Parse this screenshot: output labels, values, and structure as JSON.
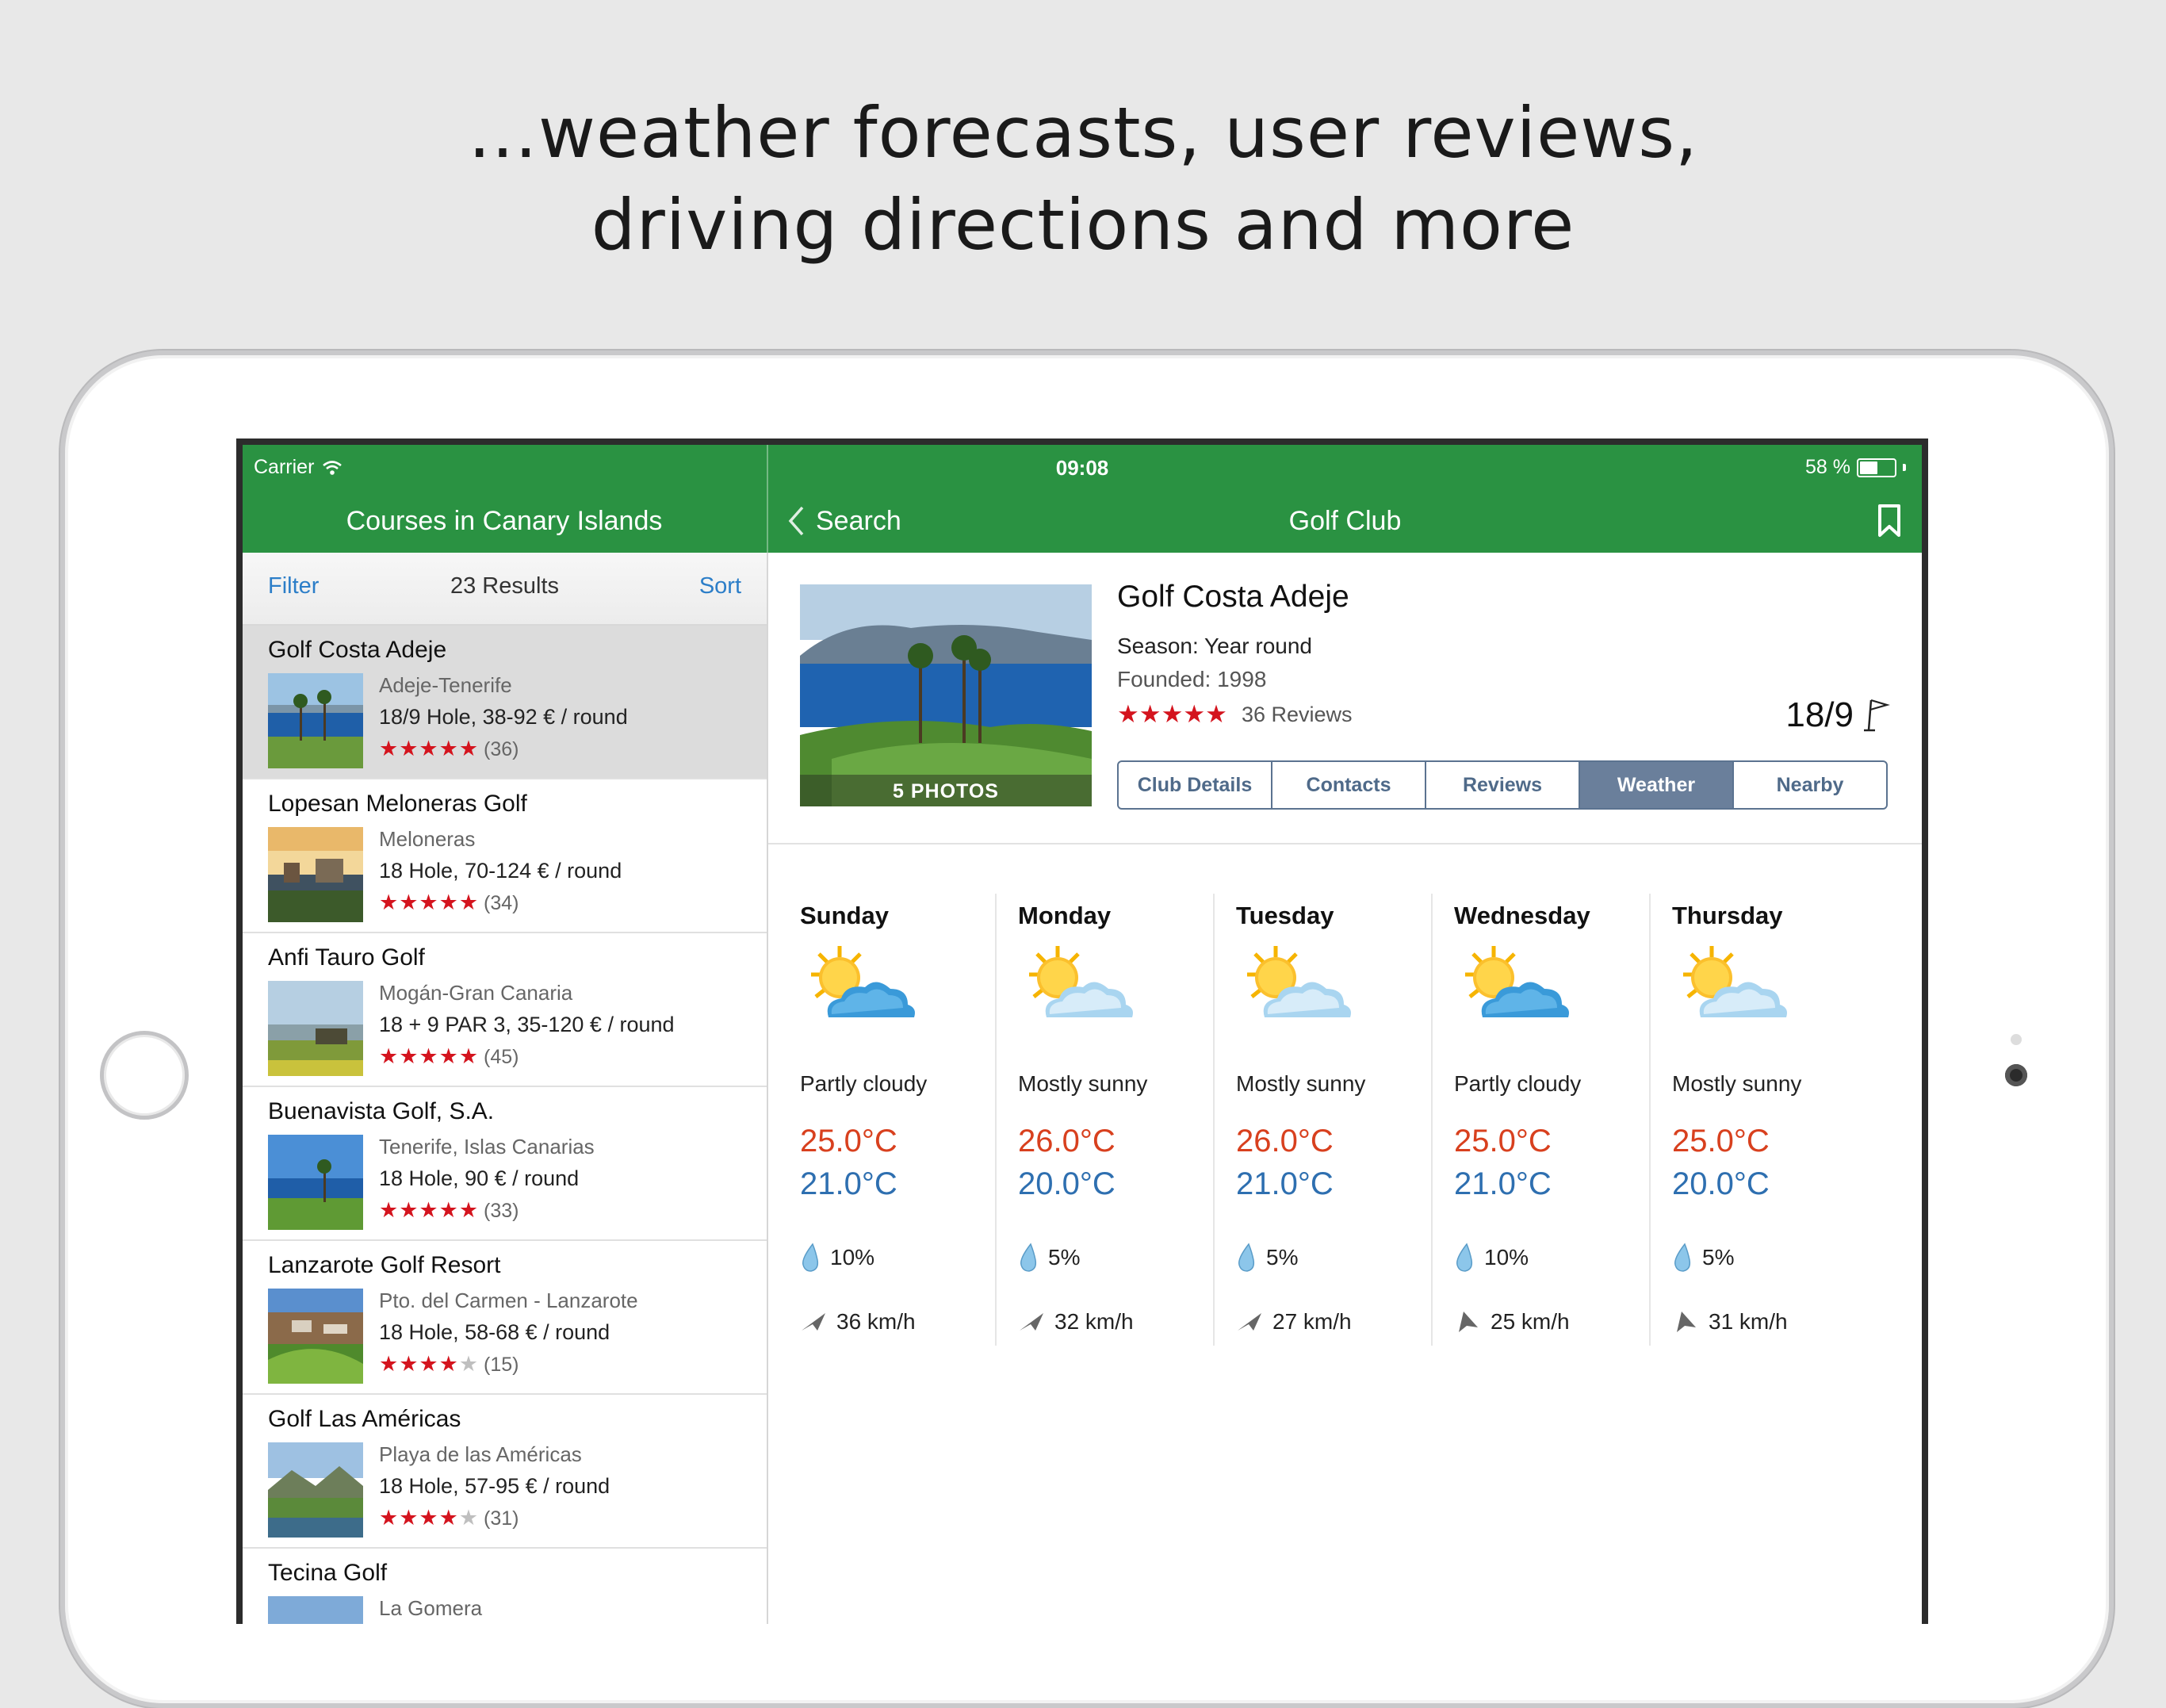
{
  "headline": {
    "line1": "…weather forecasts, user reviews,",
    "line2": "driving directions and more"
  },
  "status_bar": {
    "carrier": "Carrier",
    "time": "09:08",
    "battery": "58 %",
    "battery_level": 0.58
  },
  "nav": {
    "left_title": "Courses in Canary Islands",
    "back_label": "Search",
    "right_title": "Golf Club"
  },
  "list": {
    "filter_label": "Filter",
    "results": "23 Results",
    "sort_label": "Sort",
    "courses": [
      {
        "name": "Golf Costa Adeje",
        "location": "Adeje-Tenerife",
        "info": "18/9 Hole, 38-92 € / round",
        "stars": "★★★★★",
        "rating": 4.5,
        "count": "(36)"
      },
      {
        "name": "Lopesan Meloneras Golf",
        "location": "Meloneras",
        "info": "18 Hole, 70-124 € / round",
        "stars": "★★★★★",
        "rating": 4.5,
        "count": "(34)"
      },
      {
        "name": "Anfi Tauro Golf",
        "location": "Mogán-Gran Canaria",
        "info": "18 + 9 PAR 3, 35-120 € / round",
        "stars": "★★★★★",
        "rating": 4.5,
        "count": "(45)"
      },
      {
        "name": "Buenavista Golf, S.A.",
        "location": "Tenerife, Islas Canarias",
        "info": "18 Hole, 90 € / round",
        "stars": "★★★★★",
        "rating": 4.5,
        "count": "(33)"
      },
      {
        "name": "Lanzarote Golf Resort",
        "location": "Pto. del Carmen - Lanzarote",
        "info": "18 Hole, 58-68 € / round",
        "stars": "★★★★",
        "rating": 4,
        "count": "(15)"
      },
      {
        "name": "Golf Las Américas",
        "location": "Playa de las Américas",
        "info": "18 Hole, 57-95 € / round",
        "stars": "★★★★",
        "rating": 4,
        "count": "(31)"
      },
      {
        "name": "Tecina Golf",
        "location": "La Gomera",
        "info": "",
        "stars": "",
        "rating": 0,
        "count": ""
      }
    ]
  },
  "club": {
    "photos": "5 PHOTOS",
    "name": "Golf Costa Adeje",
    "season": "Season: Year round",
    "founded": "Founded: 1998",
    "stars": "★★★★★",
    "rating": 4.5,
    "reviews": "36 Reviews",
    "holes": "18/9",
    "tabs": [
      "Club Details",
      "Contacts",
      "Reviews",
      "Weather",
      "Nearby"
    ],
    "active_tab": "Weather"
  },
  "forecast": [
    {
      "day": "Sunday",
      "desc": "Partly cloudy",
      "hi": "25.0°C",
      "lo": "21.0°C",
      "rain": "10%",
      "wind": "36 km/h",
      "icon": "partly-cloudy-icon"
    },
    {
      "day": "Monday",
      "desc": "Mostly sunny",
      "hi": "26.0°C",
      "lo": "20.0°C",
      "rain": "5%",
      "wind": "32 km/h",
      "icon": "mostly-sunny-icon"
    },
    {
      "day": "Tuesday",
      "desc": "Mostly sunny",
      "hi": "26.0°C",
      "lo": "21.0°C",
      "rain": "5%",
      "wind": "27 km/h",
      "icon": "mostly-sunny-icon"
    },
    {
      "day": "Wednesday",
      "desc": "Partly cloudy",
      "hi": "25.0°C",
      "lo": "21.0°C",
      "rain": "10%",
      "wind": "25 km/h",
      "icon": "partly-cloudy-icon"
    },
    {
      "day": "Thursday",
      "desc": "Mostly sunny",
      "hi": "25.0°C",
      "lo": "20.0°C",
      "rain": "5%",
      "wind": "31 km/h",
      "icon": "mostly-sunny-icon"
    }
  ],
  "colors": {
    "nav_green": "#2a9242",
    "star_red": "#d4141e",
    "temp_high": "#d8401e",
    "temp_low": "#2e6fb0",
    "tab_accent": "#6a7f9b",
    "link_blue": "#2c7ec8"
  }
}
